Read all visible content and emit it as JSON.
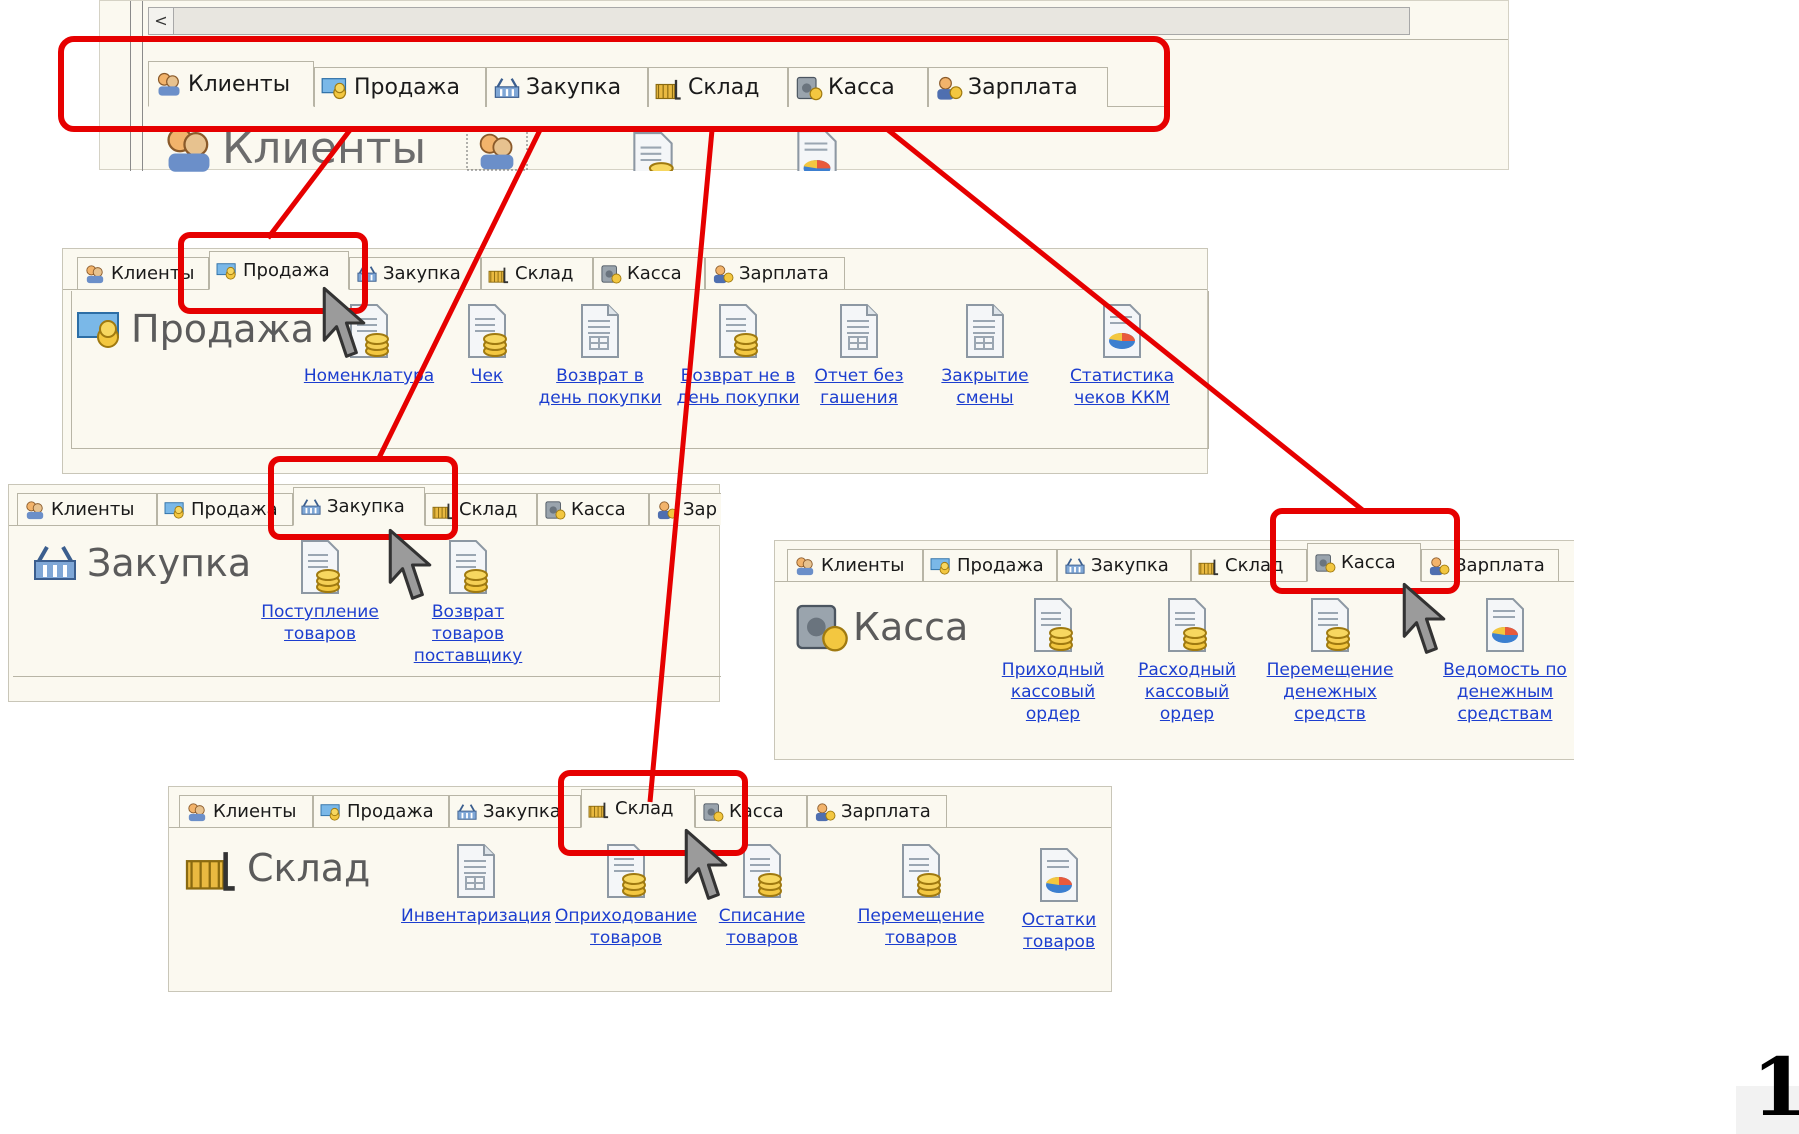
{
  "top": {
    "tabs": [
      "Клиенты",
      "Продажа",
      "Закупка",
      "Склад",
      "Касса",
      "Зарплата"
    ],
    "title": "Клиенты",
    "scroll_left": "<"
  },
  "prodazha": {
    "tabs": [
      "Клиенты",
      "Продажа",
      "Закупка",
      "Склад",
      "Касса",
      "Зарплата"
    ],
    "title": "Продажа",
    "commands": [
      [
        "Номенклатура"
      ],
      [
        "Чек"
      ],
      [
        "Возврат в",
        "день покупки"
      ],
      [
        "Возврат не в",
        "день покупки"
      ],
      [
        "Отчет без",
        "гашения"
      ],
      [
        "Закрытие",
        "смены"
      ],
      [
        "Статистика",
        "чеков ККМ"
      ]
    ]
  },
  "zakupka": {
    "tabs": [
      "Клиенты",
      "Продажа",
      "Закупка",
      "Склад",
      "Касса",
      "Зар"
    ],
    "title": "Закупка",
    "commands": [
      [
        "Поступление",
        "товаров"
      ],
      [
        "Возврат",
        "товаров",
        "поставщику"
      ]
    ]
  },
  "kassa": {
    "tabs": [
      "Клиенты",
      "Продажа",
      "Закупка",
      "Склад",
      "Касса",
      "Зарплата"
    ],
    "title": "Касса",
    "commands": [
      [
        "Приходный",
        "кассовый",
        "ордер"
      ],
      [
        "Расходный",
        "кассовый",
        "ордер"
      ],
      [
        "Перемещение",
        "денежных",
        "средств"
      ],
      [
        "Ведомость по",
        "денежным",
        "средствам"
      ]
    ]
  },
  "sklad": {
    "tabs": [
      "Клиенты",
      "Продажа",
      "Закупка",
      "Склад",
      "Касса",
      "Зарплата"
    ],
    "title": "Склад",
    "commands": [
      [
        "Инвентаризация"
      ],
      [
        "Оприходование",
        "товаров"
      ],
      [
        "Списание",
        "товаров"
      ],
      [
        "Перемещение",
        "товаров"
      ],
      [
        "Остатки",
        "товаров"
      ]
    ]
  },
  "page_number": "1",
  "colors": {
    "highlight": "#e60000",
    "link": "#1c3ecf",
    "panel": "#fbf9f0",
    "title": "#5b5b5b"
  }
}
